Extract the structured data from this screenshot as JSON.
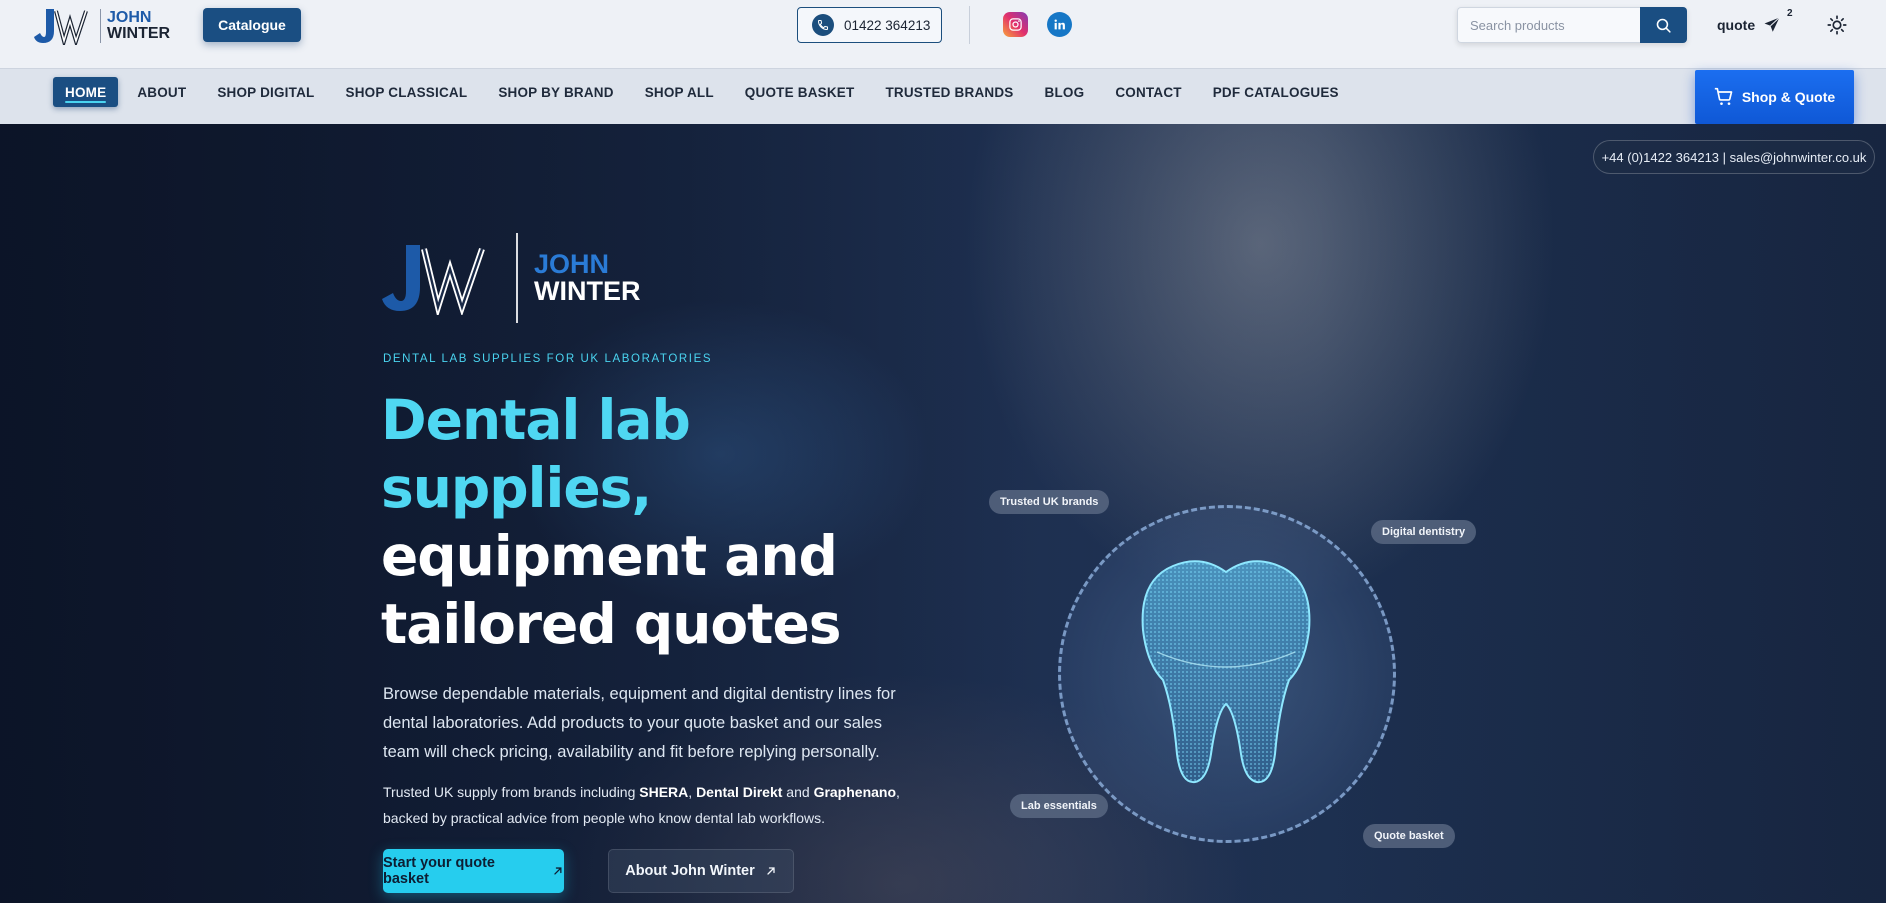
{
  "brand": {
    "line1": "JOHN",
    "line2": "WINTER"
  },
  "header": {
    "catalogue_label": "Catalogue",
    "phone": "01422 364213",
    "search_placeholder": "Search products",
    "quote_label": "quote",
    "quote_count": "2"
  },
  "nav": {
    "items": [
      "HOME",
      "ABOUT",
      "SHOP DIGITAL",
      "SHOP CLASSICAL",
      "SHOP BY BRAND",
      "SHOP ALL",
      "QUOTE BASKET",
      "TRUSTED BRANDS",
      "BLOG",
      "CONTACT",
      "PDF CATALOGUES"
    ],
    "active_index": 0,
    "shop_quote_label": "Shop & Quote"
  },
  "hero": {
    "contact": "+44 (0)1422 364213 | sales@johnwinter.co.uk",
    "eyebrow": "DENTAL LAB SUPPLIES FOR UK LABORATORIES",
    "headline_accent_1": "Dental lab",
    "headline_accent_2": "supplies,",
    "headline_white_1": "equipment and",
    "headline_white_2": "tailored quotes",
    "lead": "Browse dependable materials, equipment and digital dentistry lines for dental laboratories. Add products to your quote basket and our sales team will check pricing, availability and fit before replying personally.",
    "sub_pre": "Trusted UK supply from brands including ",
    "brand_1": "SHERA",
    "sub_sep_1": ", ",
    "brand_2": "Dental Direkt",
    "sub_sep_2": " and ",
    "brand_3": "Graphenano",
    "sub_post": ", backed by practical advice from people who know dental lab workflows.",
    "cta_primary": "Start your quote basket",
    "cta_secondary": "About John Winter",
    "chips": [
      "Trusted UK brands",
      "Digital dentistry",
      "Lab essentials",
      "Quote basket"
    ]
  },
  "colors": {
    "brand_navy": "#1a4e82",
    "accent_cyan": "#4fd7f2",
    "shop_quote_blue": "#1b6ef0"
  },
  "icons": [
    "phone-icon",
    "instagram-icon",
    "linkedin-icon",
    "search-icon",
    "send-icon",
    "sun-icon",
    "cart-icon",
    "arrow-up-right-icon"
  ]
}
